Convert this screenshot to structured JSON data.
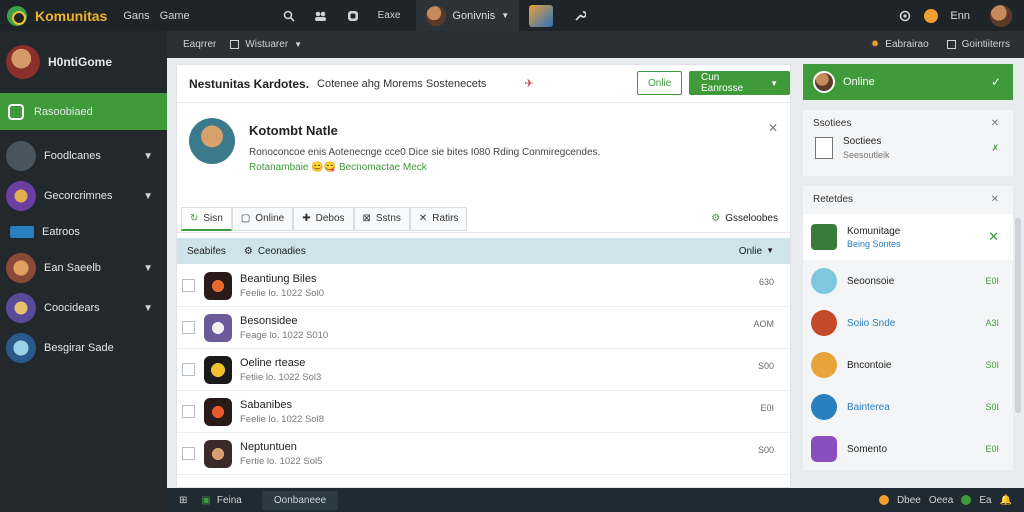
{
  "topbar": {
    "brand": "Komunitas",
    "links": [
      "Gans",
      "Game"
    ],
    "active_label": "Gonivnis",
    "right_label": "Enn"
  },
  "subbar": {
    "left_item1": "Eaqrrer",
    "left_item2": "Wistuarer",
    "right_item1": "Eabrairao",
    "right_item2": "Gointiiterrs"
  },
  "sidebar": {
    "profile_name": "H0ntiGome",
    "active_item": "Rasoobiaed",
    "items": [
      {
        "label": "Foodlcanes",
        "chevron": true
      },
      {
        "label": "Gecorcrimnes",
        "chevron": true
      },
      {
        "label": "Eatroos",
        "chevron": false
      },
      {
        "label": "Ean Saeelb",
        "chevron": true
      },
      {
        "label": "Coocidears",
        "chevron": true
      },
      {
        "label": "Besgirar Sade",
        "chevron": false
      }
    ]
  },
  "main": {
    "title": "Nestunitas Kardotes.",
    "subtitle": "Cotenee ahg Morems Sostenecets",
    "btn_online": "Onlie",
    "btn_dropdown": "Cun Eanrosse",
    "profile": {
      "name": "Kotombt Natle",
      "desc": "Ronoconcoe enis Aotenecnge cce0 Dice sie bites I080 Rding Conmiregcendes.",
      "link": "Rotanambaie 😊😋 Becnomactae Meck"
    },
    "tabs": [
      "Sisn",
      "Online",
      "Debos",
      "Sstns",
      "Ratirs"
    ],
    "tab_right": "Gsseloobes",
    "list_header": {
      "col1": "Seabifes",
      "col2": "Ceonadies",
      "col3": "Onlie"
    },
    "rows": [
      {
        "title": "Beantiung Biles",
        "sub": "Feelie lo. 1022 Sol0",
        "time": "630"
      },
      {
        "title": "Besonsidee",
        "sub": "Feage lo. 1022 S010",
        "time": "AOM"
      },
      {
        "title": "Oeline rtease",
        "sub": "Fetiie lo. 1022 Sol3",
        "time": "S00"
      },
      {
        "title": "Sabanibes",
        "sub": "Feelie lo. 1022 Sol8",
        "time": "E0I"
      },
      {
        "title": "Neptuntuen",
        "sub": "Fertie lo. 1022 Sol5",
        "time": "S00"
      }
    ]
  },
  "rpanel": {
    "online_label": "Online",
    "sections": [
      {
        "title": "Ssotiees",
        "item": "Soctiees",
        "item_sub": "Seesoutleik"
      }
    ],
    "friends_title": "Retetdes",
    "friends": [
      {
        "name": "Komunitage",
        "sub": "Being Sontes",
        "status": "",
        "color": "#3a7a3a"
      },
      {
        "name": "Seoonsoie",
        "sub": "",
        "status": "E0I",
        "color": "#7dc8de"
      },
      {
        "name": "Soiio Snde",
        "sub": "",
        "status": "A3I",
        "color": "#c44a2a"
      },
      {
        "name": "Bncontoie",
        "sub": "",
        "status": "S0I",
        "color": "#e8a33a"
      },
      {
        "name": "Bainterea",
        "sub": "",
        "status": "S0I",
        "color": "#2a7fbf"
      },
      {
        "name": "Somento",
        "sub": "",
        "status": "E0I",
        "color": "#8a4fbf"
      }
    ]
  },
  "bottombar": {
    "item1": "Feina",
    "item2": "Oonbaneee",
    "right1": "Dbee",
    "right2": "Oeea",
    "right3": "Ea"
  },
  "colors": {
    "accent": "#3f9a3a",
    "dark": "#23282c",
    "topbar": "#1f2428"
  }
}
